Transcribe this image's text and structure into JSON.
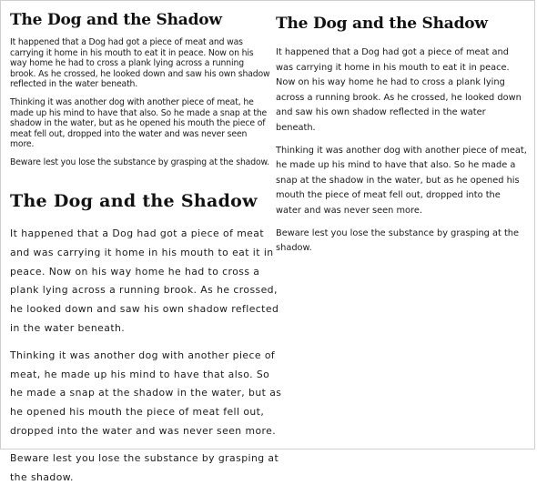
{
  "story": {
    "title": "The Dog and the Shadow",
    "paragraphs": [
      "It happened that a Dog had got a piece of meat and was carrying it home in his mouth to eat it in peace. Now on his way home he had to cross a plank lying across a running brook. As he crossed, he looked down and saw his own shadow reflected in the water beneath.",
      "Thinking it was another dog with another piece of meat, he made up his mind to have that also. So he made a snap at the shadow in the water, but as he opened his mouth the piece of meat fell out, dropped into the water and was never seen more.",
      "Beware lest you lose the substance by grasping at the shadow."
    ]
  }
}
